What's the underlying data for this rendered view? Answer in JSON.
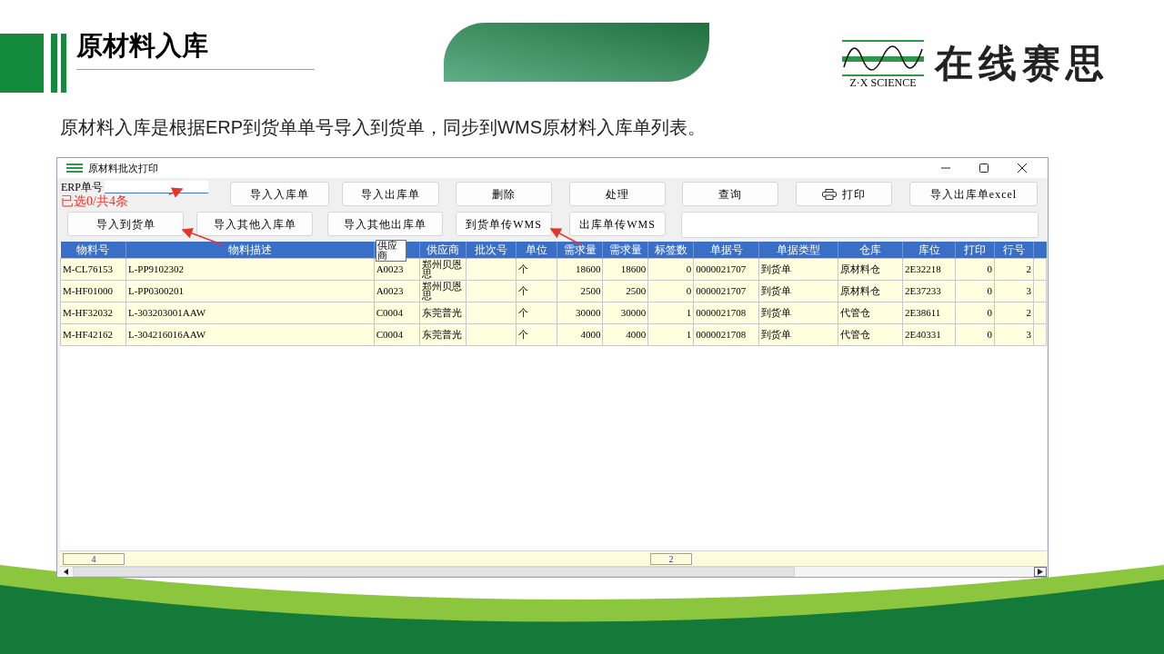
{
  "slide": {
    "title": "原材料入库",
    "description": "原材料入库是根据ERP到货单单号导入到货单，同步到WMS原材料入库单列表。",
    "logo": {
      "tagline": "Z·X SCIENCE",
      "name": "在线赛思"
    }
  },
  "window": {
    "title": "原材料批次打印",
    "erp_field": {
      "label": "ERP单号"
    },
    "selection_status": "已选0/共4条",
    "toolbar_row_1": [
      {
        "label": "导入入库单",
        "kind": "text"
      },
      {
        "label": "导入出库单",
        "kind": "text"
      },
      {
        "label": "删除",
        "kind": "text"
      },
      {
        "label": "处理",
        "kind": "text"
      },
      {
        "label": "查询",
        "kind": "text"
      },
      {
        "label": "打印",
        "kind": "print"
      },
      {
        "label": "导入出库单excel",
        "kind": "text"
      }
    ],
    "toolbar_row_2": [
      {
        "label": "导入到货单"
      },
      {
        "label": "导入其他入库单"
      },
      {
        "label": "导入其他出库单"
      },
      {
        "label": "到货单传WMS"
      },
      {
        "label": "出库单传WMS"
      }
    ],
    "table": {
      "columns": [
        {
          "label": "物料号"
        },
        {
          "label": "物料描述"
        },
        {
          "tooltip": "供应商"
        },
        {
          "label": "供应商"
        },
        {
          "label": "批次号"
        },
        {
          "label": "单位"
        },
        {
          "label": "需求量"
        },
        {
          "label": "需求量"
        },
        {
          "label": "标签数"
        },
        {
          "label": "单据号"
        },
        {
          "label": "单据类型"
        },
        {
          "label": "仓库"
        },
        {
          "label": "库位"
        },
        {
          "label": "打印"
        },
        {
          "label": "行号"
        }
      ],
      "rows": [
        {
          "material_no": "M-CL76153",
          "description": "L-PP9102302",
          "supplier_code": "A0023",
          "supplier": "郑州贝恩思",
          "unit": "个",
          "demand_qty": "18600",
          "demand_qty_2": "18600",
          "label_count": "0",
          "doc_no": "0000021707",
          "doc_type": "到货单",
          "warehouse": "原材料仓",
          "location": "2E32218",
          "print": "0",
          "line_no": "2"
        },
        {
          "material_no": "M-HF01000",
          "description": "L-PP0300201",
          "supplier_code": "A0023",
          "supplier": "郑州贝恩思",
          "unit": "个",
          "demand_qty": "2500",
          "demand_qty_2": "2500",
          "label_count": "0",
          "doc_no": "0000021707",
          "doc_type": "到货单",
          "warehouse": "原材料仓",
          "location": "2E37233",
          "print": "0",
          "line_no": "3"
        },
        {
          "material_no": "M-HF32032",
          "description": "L-303203001AAW",
          "supplier_code": "C0004",
          "supplier": "东莞普光",
          "unit": "个",
          "demand_qty": "30000",
          "demand_qty_2": "30000",
          "label_count": "1",
          "doc_no": "0000021708",
          "doc_type": "到货单",
          "warehouse": "代管仓",
          "location": "2E38611",
          "print": "0",
          "line_no": "2"
        },
        {
          "material_no": "M-HF42162",
          "description": "L-304216016AAW",
          "supplier_code": "C0004",
          "supplier": "东莞普光",
          "unit": "个",
          "demand_qty": "4000",
          "demand_qty_2": "4000",
          "label_count": "1",
          "doc_no": "0000021708",
          "doc_type": "到货单",
          "warehouse": "代管仓",
          "location": "2E40331",
          "print": "0",
          "line_no": "3"
        }
      ],
      "summary": {
        "row_count": "4",
        "label_total": "2"
      }
    }
  }
}
